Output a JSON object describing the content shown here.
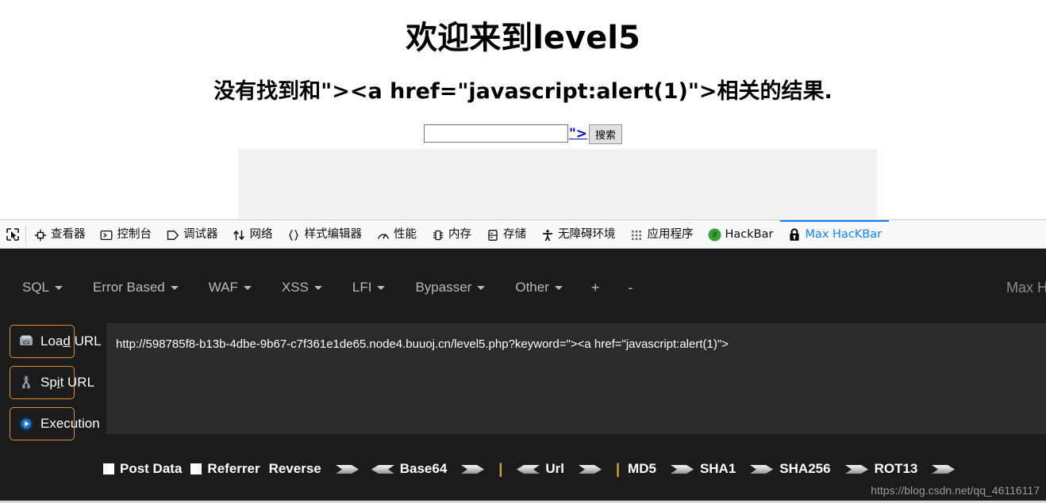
{
  "page": {
    "heading": "欢迎来到level5",
    "subheading": "没有找到和\"><a href=\"javascript:alert(1)\">相关的结果.",
    "injected_link_text": "\">",
    "search_value": "",
    "search_placeholder": "",
    "search_button": "搜索"
  },
  "devtools": {
    "picker_icon": "element-picker-icon",
    "tabs": [
      {
        "label": "查看器",
        "icon": "inspector-icon",
        "active": false
      },
      {
        "label": "控制台",
        "icon": "console-icon",
        "active": false
      },
      {
        "label": "调试器",
        "icon": "debugger-icon",
        "active": false
      },
      {
        "label": "网络",
        "icon": "network-icon",
        "active": false
      },
      {
        "label": "样式编辑器",
        "icon": "style-editor-icon",
        "active": false
      },
      {
        "label": "性能",
        "icon": "performance-icon",
        "active": false
      },
      {
        "label": "内存",
        "icon": "memory-icon",
        "active": false
      },
      {
        "label": "存储",
        "icon": "storage-icon",
        "active": false
      },
      {
        "label": "无障碍环境",
        "icon": "accessibility-icon",
        "active": false
      },
      {
        "label": "应用程序",
        "icon": "application-icon",
        "active": false
      },
      {
        "label": "HackBar",
        "icon": "hackbar-icon",
        "active": false
      },
      {
        "label": "Max HacKBar",
        "icon": "lock-icon",
        "active": true
      }
    ],
    "active_tab_color": "#0a84ff"
  },
  "hackbar": {
    "brand": "Max HackBa",
    "accent_color": "#e08a2e",
    "menu": [
      {
        "label": "SQL",
        "caret": true
      },
      {
        "label": "Error Based",
        "caret": true
      },
      {
        "label": "WAF",
        "caret": true
      },
      {
        "label": "XSS",
        "caret": true
      },
      {
        "label": "LFI",
        "caret": true
      },
      {
        "label": "Bypasser",
        "caret": true
      },
      {
        "label": "Other",
        "caret": true
      }
    ],
    "add_button": "+",
    "remove_button": "-",
    "buttons": [
      {
        "label_pre": "Loa",
        "label_key": "d",
        "label_post": " URL",
        "icon": "load-url-icon",
        "name": "load-url-button"
      },
      {
        "label_pre": "Sp",
        "label_key": "i",
        "label_post": "t URL",
        "icon": "split-url-icon",
        "name": "split-url-button"
      },
      {
        "label_pre": "Execution",
        "label_key": "",
        "label_post": "",
        "icon": "execution-icon",
        "name": "execution-button"
      }
    ],
    "url_value": "http://598785f8-b13b-4dbe-9b67-c7f361e1de65.node4.buuoj.cn/level5.php?keyword=\"><a href=\"javascript:alert(1)\">",
    "url_placeholder": "",
    "footer": {
      "post_data_label": "Post Data",
      "referrer_label": "Referrer",
      "reverse_label": "Reverse",
      "base64_label": "Base64",
      "url_label": "Url",
      "md5_label": "MD5",
      "sha1_label": "SHA1",
      "sha256_label": "SHA256",
      "rot13_label": "ROT13",
      "post_data_checked": false,
      "referrer_checked": false
    }
  },
  "watermark": "https://blog.csdn.net/qq_46116117"
}
